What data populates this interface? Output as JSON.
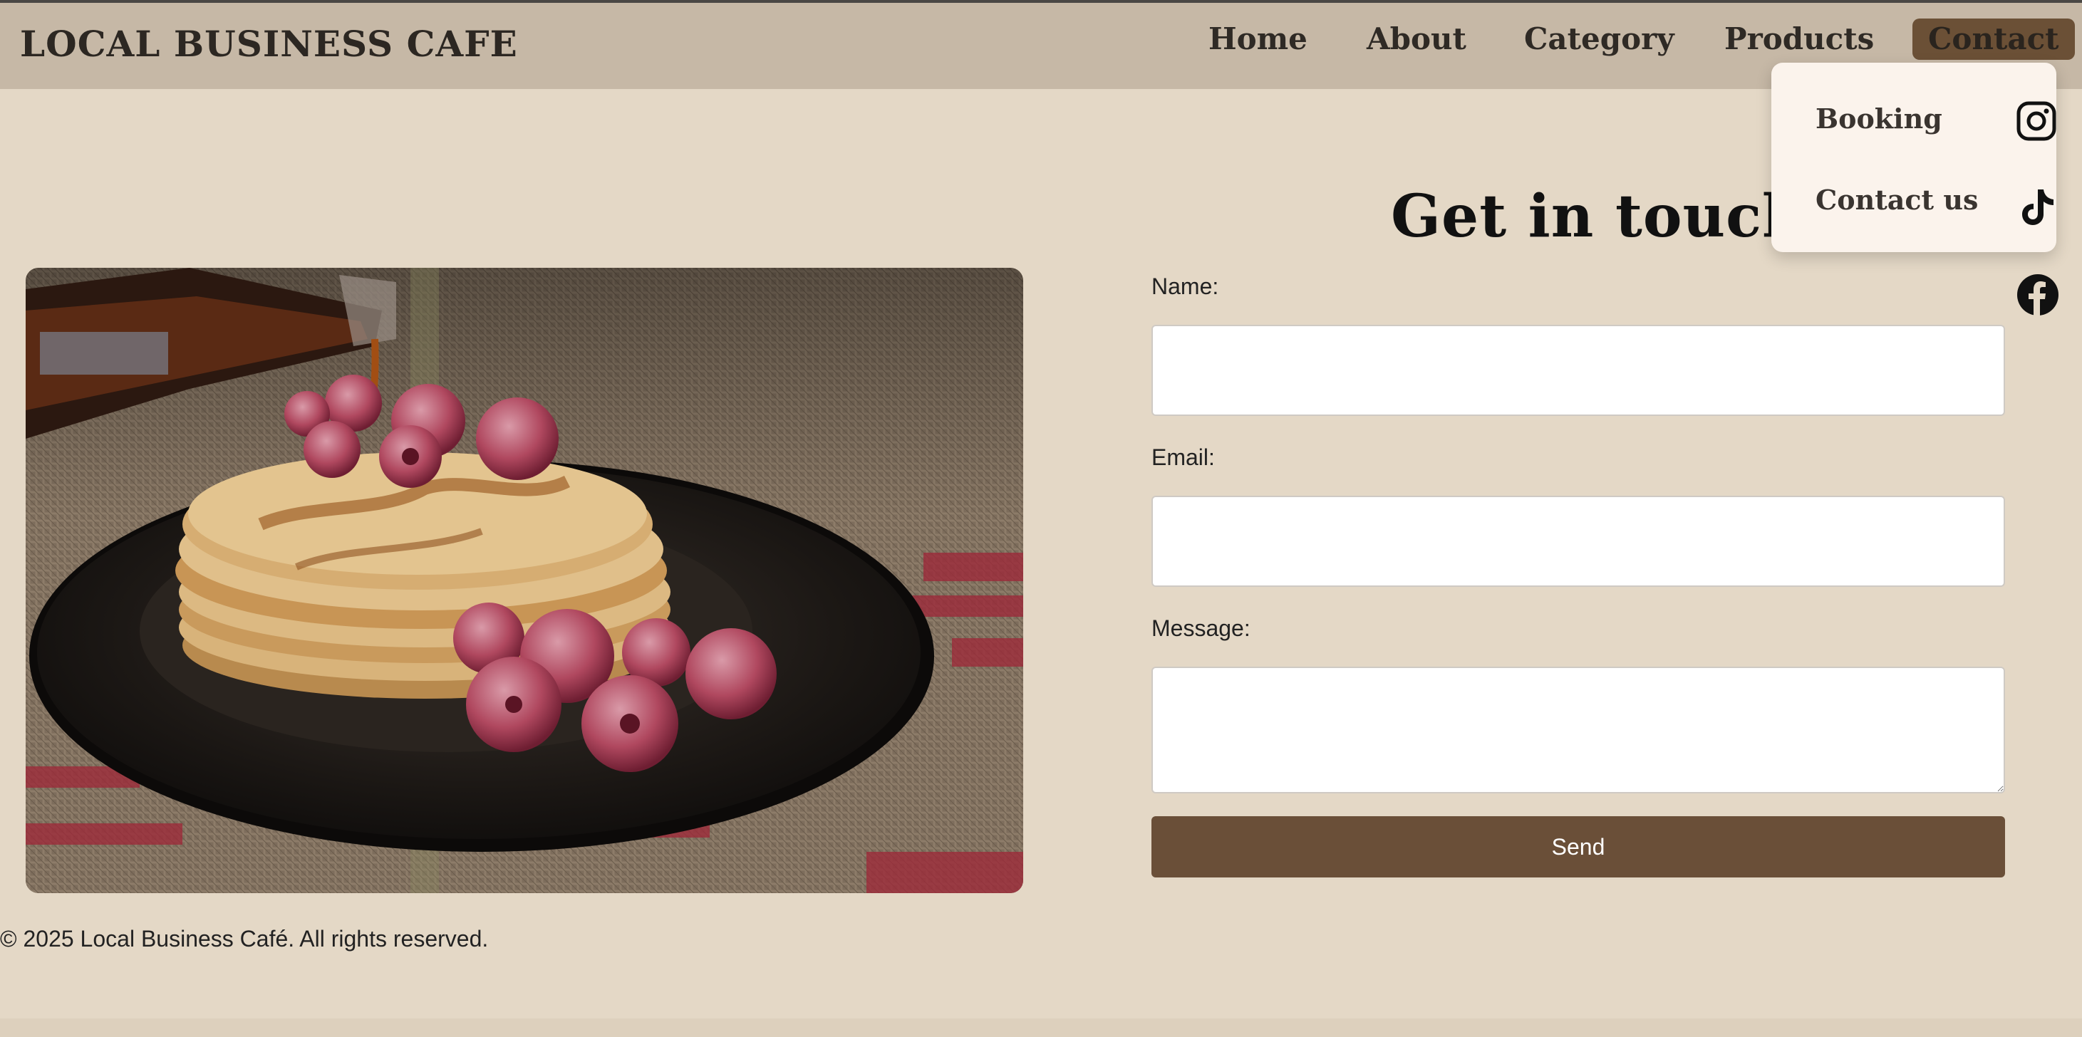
{
  "nav": {
    "brand": "LOCAL BUSINESS CAFE",
    "items": [
      {
        "label": "Home"
      },
      {
        "label": "About"
      },
      {
        "label": "Category"
      },
      {
        "label": "Products"
      },
      {
        "label": "Contact"
      }
    ],
    "dropdown": [
      {
        "label": "Booking"
      },
      {
        "label": "Contact us"
      }
    ]
  },
  "social": {
    "icons": [
      "instagram-icon",
      "tiktok-icon",
      "facebook-icon"
    ]
  },
  "main": {
    "title": "Get in touch",
    "form": {
      "name_label": "Name:",
      "email_label": "Email:",
      "message_label": "Message:",
      "name_value": "",
      "email_value": "",
      "message_value": "",
      "send_label": "Send"
    }
  },
  "footer": {
    "text": "© 2025 Local Business Café. All rights reserved."
  },
  "colors": {
    "background": "#e4d8c6",
    "navbar": "#c6b8a6",
    "active_nav": "#6b5036",
    "button": "#6a4f38",
    "dropdown": "#fbf3ec"
  }
}
